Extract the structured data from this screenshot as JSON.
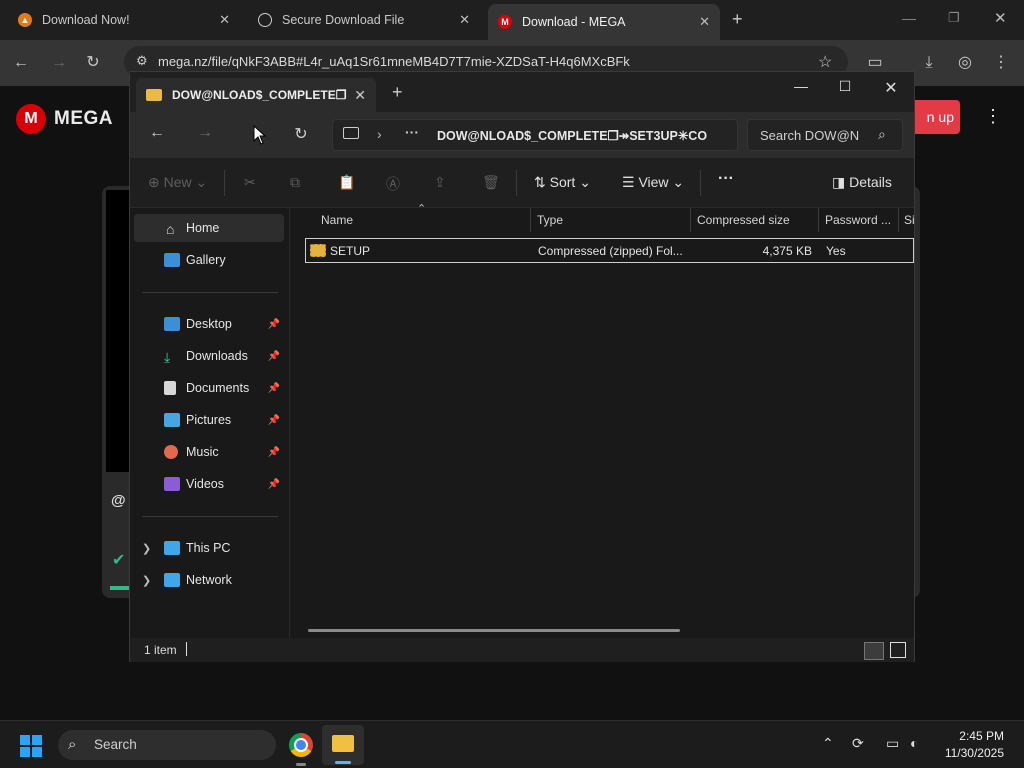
{
  "browser": {
    "tabs": [
      {
        "title": "Download Now!",
        "favicon": "fruity-loops-icon"
      },
      {
        "title": "Secure Download File",
        "favicon": "globe-icon"
      },
      {
        "title": "Download - MEGA",
        "favicon": "mega-icon",
        "active": true
      }
    ],
    "new_tab": "+",
    "url": "mega.nz/file/qNkF3ABB#L4r_uAq1Sr61mneMB4D7T7mie-XZDSaT-H4q6MXcBFk"
  },
  "mega_page": {
    "logo_letter": "M",
    "logo_text": "MEGA",
    "signup_label": "n up",
    "at_text": "@",
    "brand_color": "#d90007"
  },
  "explorer": {
    "tab_title": "DOW@NLOAD$_COMPLETE❐",
    "address_path": "DOW@NLOAD$_COMPLETE❐↠SET3UP✳CO",
    "search_placeholder": "Search DOW@N",
    "toolbar": {
      "new_label": "New",
      "sort_label": "Sort",
      "view_label": "View",
      "more_label": "···",
      "details_label": "Details"
    },
    "sidebar": {
      "top": [
        {
          "label": "Home",
          "icon": "home-icon",
          "selected": true
        },
        {
          "label": "Gallery",
          "icon": "gallery-icon"
        }
      ],
      "quick_access": [
        {
          "label": "Desktop",
          "icon": "desktop-icon",
          "pinned": true
        },
        {
          "label": "Downloads",
          "icon": "downloads-icon",
          "pinned": true
        },
        {
          "label": "Documents",
          "icon": "documents-icon",
          "pinned": true
        },
        {
          "label": "Pictures",
          "icon": "pictures-icon",
          "pinned": true
        },
        {
          "label": "Music",
          "icon": "music-icon",
          "pinned": true
        },
        {
          "label": "Videos",
          "icon": "videos-icon",
          "pinned": true
        }
      ],
      "devices": [
        {
          "label": "This PC",
          "icon": "this-pc-icon"
        },
        {
          "label": "Network",
          "icon": "network-icon"
        }
      ]
    },
    "columns": [
      "Name",
      "Type",
      "Compressed size",
      "Password ...",
      "Si"
    ],
    "rows": [
      {
        "name": "SETUP",
        "type": "Compressed (zipped) Fol...",
        "size": "4,375 KB",
        "password": "Yes"
      }
    ],
    "status": "1 item"
  },
  "taskbar": {
    "search_label": "Search",
    "time": "2:45 PM",
    "date": "11/30/2025"
  }
}
